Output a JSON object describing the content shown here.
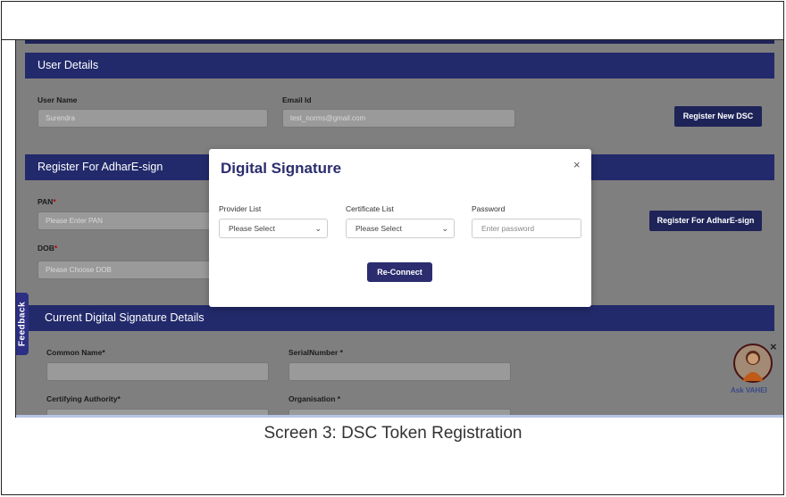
{
  "user_details": {
    "header": "User Details",
    "username_label": "User Name",
    "username_value": "Surendra",
    "email_label": "Email Id",
    "email_value": "test_norms@gmail.com",
    "register_dsc_button": "Register New DSC"
  },
  "adhar": {
    "header": "Register For AdharE-sign",
    "pan_label": "PAN",
    "pan_placeholder": "Please Enter PAN",
    "dob_label": "DOB",
    "dob_placeholder": "Please Choose DOB",
    "register_button": "Register For AdharE-sign"
  },
  "current_dsc": {
    "header": "Current Digital Signature Details",
    "common_name_label": "Common Name*",
    "serial_label": "SerialNumber *",
    "authority_label": "Certifying Authority*",
    "organisation_label": "Organisation *"
  },
  "modal": {
    "title": "Digital Signature",
    "close_glyph": "×",
    "provider_label": "Provider List",
    "provider_value": "Please Select",
    "certificate_label": "Certificate List",
    "certificate_value": "Please Select",
    "password_label": "Password",
    "password_placeholder": "Enter password",
    "reconnect_button": "Re-Connect"
  },
  "feedback_tab": "Feedback",
  "assistant": {
    "label": "Ask VAHEI",
    "close_glyph": "×"
  },
  "caption": "Screen 3: DSC Token Registration",
  "colors": {
    "navy_header": "#222a6b",
    "modal_accent": "#2b2d6e",
    "overlay_gray": "#7f7f7f"
  }
}
